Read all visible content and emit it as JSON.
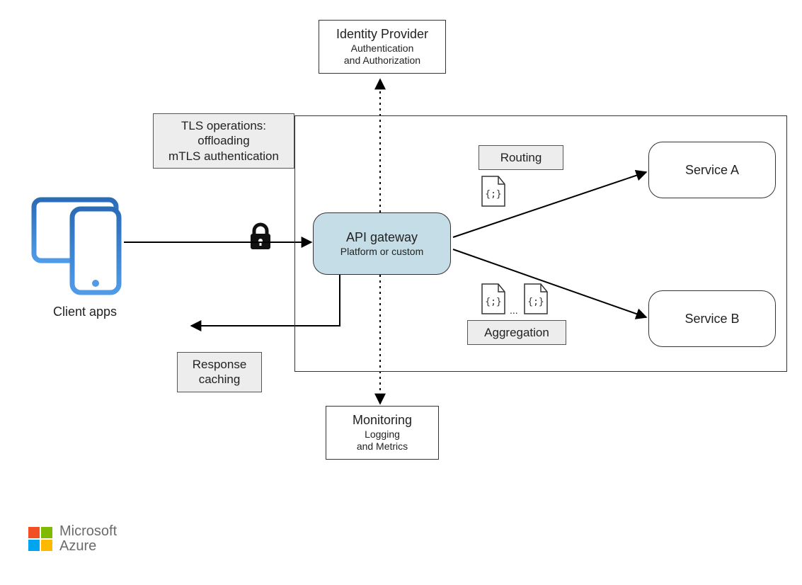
{
  "identity_provider": {
    "title": "Identity Provider",
    "sub1": "Authentication",
    "sub2": "and Authorization"
  },
  "tls_box": {
    "line1": "TLS operations:",
    "line2": "offloading",
    "line3": "mTLS authentication"
  },
  "client_apps_caption": "Client apps",
  "gateway": {
    "title": "API gateway",
    "sub": "Platform or custom"
  },
  "routing_label": "Routing",
  "aggregation_label": "Aggregation",
  "aggregation_ellipsis": "...",
  "service_a": "Service A",
  "service_b": "Service B",
  "response_caching": {
    "line1": "Response",
    "line2": "caching"
  },
  "monitoring": {
    "title": "Monitoring",
    "sub1": "Logging",
    "sub2": "and Metrics"
  },
  "brand": {
    "line1": "Microsoft",
    "line2": "Azure"
  },
  "icons": {
    "lock": "lock-icon",
    "tablet_phone": "client-devices-icon",
    "code_file": "code-file-icon"
  },
  "colors": {
    "gateway_fill": "#c5dde7",
    "label_fill": "#ededed",
    "device_blue_dark": "#2b6cb7",
    "device_blue_light": "#4f9be8"
  }
}
